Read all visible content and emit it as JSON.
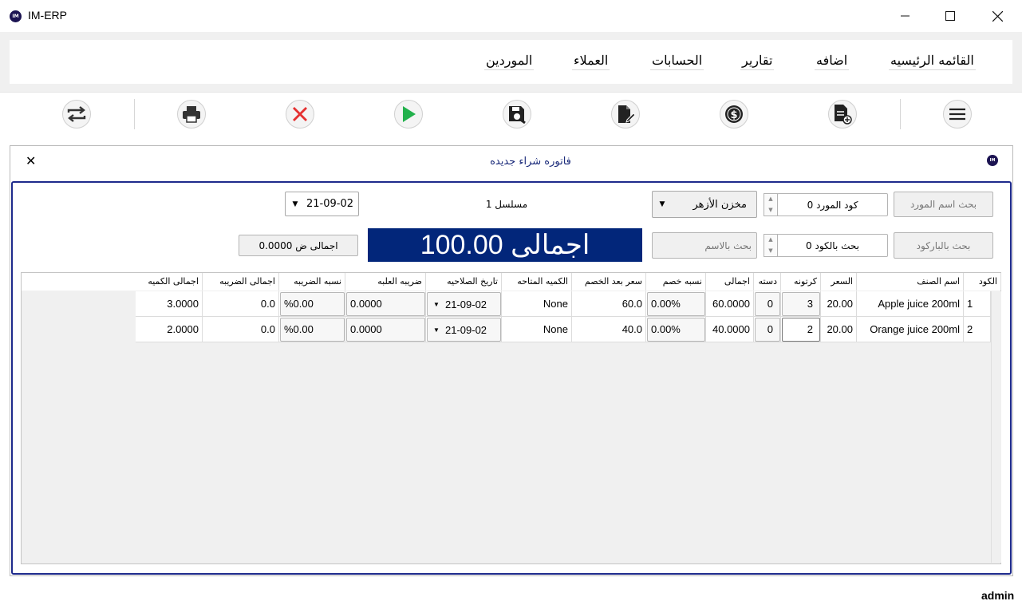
{
  "window": {
    "title": "IM-ERP",
    "logo_text": "IM"
  },
  "menu": {
    "items": [
      {
        "id": "main",
        "label": "القائمه الرئيسيه"
      },
      {
        "id": "add",
        "label": "اضافه"
      },
      {
        "id": "reports",
        "label": "تقارير"
      },
      {
        "id": "accounts",
        "label": "الحسابات"
      },
      {
        "id": "customers",
        "label": "العملاء"
      },
      {
        "id": "suppliers",
        "label": "الموردين"
      }
    ]
  },
  "toolbar": {
    "icons": [
      "hamburger-menu-icon",
      "new-document-icon",
      "money-icon",
      "edit-document-icon",
      "save-search-icon",
      "play-icon",
      "cancel-icon",
      "print-icon",
      "refresh-icon"
    ],
    "accent_play": "#22b14c",
    "accent_cancel": "#e53030"
  },
  "invoice": {
    "title": "فاتوره شراء جديده",
    "logo_text": "IM",
    "search_supplier_name_btn": "بحث اسم المورد",
    "supplier_code_label": "كود المورد 0",
    "warehouse": "مخزن الأزهر",
    "serial": "مسلسل 1",
    "date": "21-09-02",
    "search_barcode_btn": "بحث بالباركود",
    "search_code_label": "بحث بالكود 0",
    "search_name_placeholder": "بحث بالاسم",
    "grand_total": "اجمالى 100.00",
    "tax_total": "اجمالى ض 0.0000",
    "panel_border_color": "#1e2a8c",
    "total_bg_color": "#02267a"
  },
  "grid": {
    "headers": [
      "الكود",
      "اسم الصنف",
      "السعر",
      "كرتونه",
      "دسته",
      "اجمالى",
      "نسبه خصم",
      "سعر بعد الخصم",
      "الكميه المتاحه",
      "تاريخ الصلاحيه",
      "ضريبه العلبه",
      "نسبه الضريبه",
      "اجمالى الضريبه",
      "اجمالى الكميه"
    ],
    "rows": [
      {
        "row_no": "1",
        "code": "1",
        "name": "Apple juice 200ml",
        "price": "20.00",
        "carton": "3",
        "dozen": "0",
        "total": "60.0000",
        "discount_pct": "0.00%",
        "price_after_discount": "60.0",
        "available_qty": "None",
        "expiry": "21-09-02",
        "box_tax": "0.0000",
        "tax_pct": "%0.00",
        "tax_total": "0.0",
        "qty_total": "3.0000"
      },
      {
        "row_no": "2",
        "code": "2",
        "name": "Orange juice 200ml",
        "price": "20.00",
        "carton": "2",
        "dozen": "0",
        "total": "40.0000",
        "discount_pct": "0.00%",
        "price_after_discount": "40.0",
        "available_qty": "None",
        "expiry": "21-09-02",
        "box_tax": "0.0000",
        "tax_pct": "%0.00",
        "tax_total": "0.0",
        "qty_total": "2.0000"
      }
    ]
  },
  "status": {
    "user": "admin"
  }
}
